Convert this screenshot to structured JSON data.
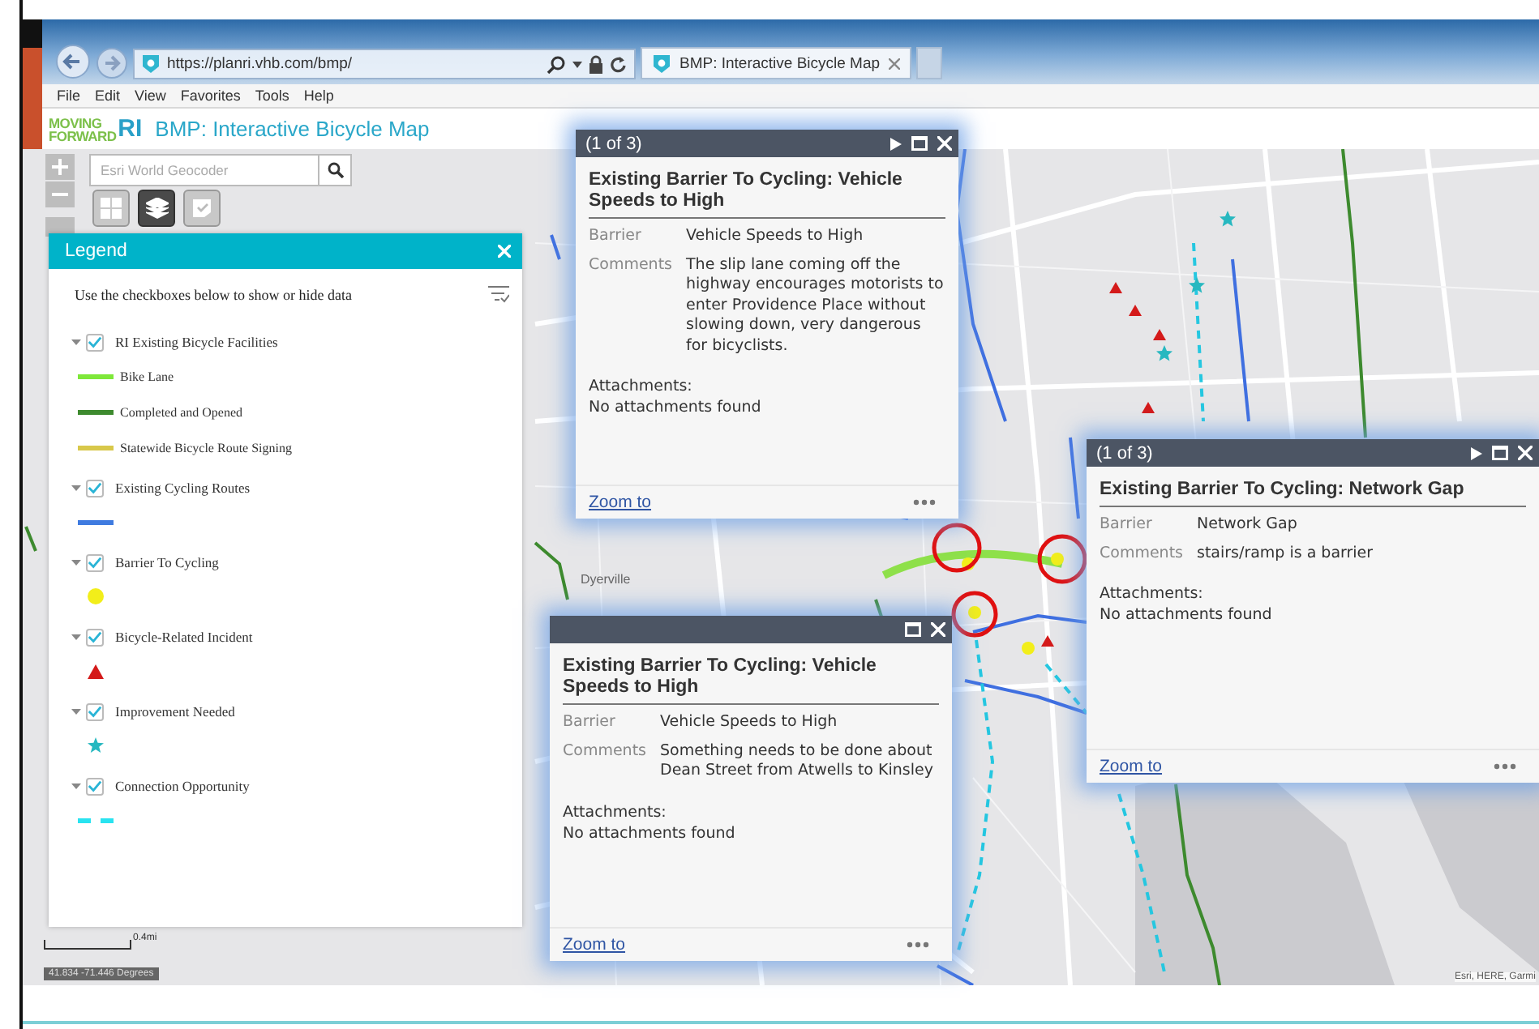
{
  "browser": {
    "url": "https://planri.vhb.com/bmp/",
    "tab_title": "BMP: Interactive Bicycle Map",
    "menu": [
      "File",
      "Edit",
      "View",
      "Favorites",
      "Tools",
      "Help"
    ]
  },
  "app": {
    "logo_top": "MOVING",
    "logo_bottom": "FORWARD",
    "logo_mark": "RI",
    "title": "BMP: Interactive Bicycle Map"
  },
  "map": {
    "geocoder_placeholder": "Esri World Geocoder",
    "tools": [
      {
        "kind": "basemap",
        "selected": false
      },
      {
        "kind": "layers",
        "selected": true
      },
      {
        "kind": "legend",
        "selected": false
      }
    ],
    "place_labels": [
      "Dyerville"
    ],
    "scale": "0.4mi",
    "coordinates": "41.834 -71.446 Degrees",
    "attribution": "Esri, HERE, Garmi"
  },
  "legend": {
    "title": "Legend",
    "instruction": "Use the checkboxes below to show or hide data",
    "layers": [
      {
        "name": "RI Existing Bicycle Facilities",
        "checked": true,
        "expanded": true,
        "symbols": [
          {
            "kind": "line",
            "color": "#7ee83a",
            "label": "Bike Lane"
          },
          {
            "kind": "line",
            "color": "#3d8a2e",
            "label": "Completed and Opened"
          },
          {
            "kind": "line",
            "color": "#d8c84a",
            "label": "Statewide Bicycle Route Signing"
          }
        ]
      },
      {
        "name": "Existing Cycling Routes",
        "checked": true,
        "expanded": true,
        "symbols": [
          {
            "kind": "line",
            "color": "#3f7be0"
          }
        ]
      },
      {
        "name": "Barrier To Cycling",
        "checked": true,
        "expanded": true,
        "symbols": [
          {
            "kind": "circle",
            "color": "#f2ee1a"
          }
        ]
      },
      {
        "name": "Bicycle-Related Incident",
        "checked": true,
        "expanded": true,
        "symbols": [
          {
            "kind": "triangle",
            "color": "#d41a1a"
          }
        ]
      },
      {
        "name": "Improvement Needed",
        "checked": true,
        "expanded": true,
        "symbols": [
          {
            "kind": "star",
            "color": "#27b8c0"
          }
        ]
      },
      {
        "name": "Connection Opportunity",
        "checked": true,
        "expanded": true,
        "symbols": [
          {
            "kind": "dashed",
            "color": "#29e3f0"
          }
        ]
      }
    ]
  },
  "popups": [
    {
      "pager": "(1 of 3)",
      "title": "Existing Barrier To Cycling: Vehicle Speeds to High",
      "fields": [
        {
          "label": "Barrier",
          "value": "Vehicle Speeds to High"
        },
        {
          "label": "Comments",
          "value": "The slip lane coming off the highway encourages motorists to enter Providence Place without slowing down, very dangerous for bicyclists."
        }
      ],
      "attachments_label": "Attachments:",
      "attachments_value": "No attachments found",
      "zoom_link": "Zoom to"
    },
    {
      "title": "Existing Barrier To Cycling: Vehicle Speeds to High",
      "fields": [
        {
          "label": "Barrier",
          "value": "Vehicle Speeds to High"
        },
        {
          "label": "Comments",
          "value": "Something needs to be done about Dean Street from Atwells to Kinsley"
        }
      ],
      "attachments_label": "Attachments:",
      "attachments_value": "No attachments found",
      "zoom_link": "Zoom to"
    },
    {
      "pager": "(1 of 3)",
      "title": "Existing Barrier To Cycling: Network Gap",
      "fields": [
        {
          "label": "Barrier",
          "value": "Network Gap"
        },
        {
          "label": "Comments",
          "value": "stairs/ramp is a barrier"
        }
      ],
      "attachments_label": "Attachments:",
      "attachments_value": "No attachments found",
      "zoom_link": "Zoom to"
    }
  ]
}
